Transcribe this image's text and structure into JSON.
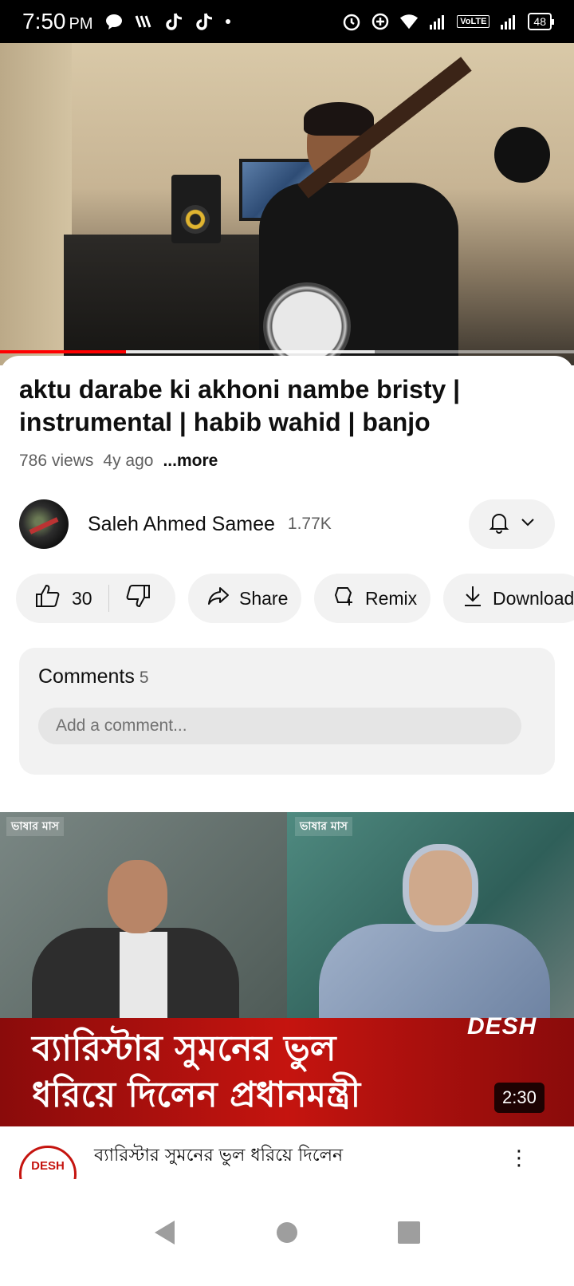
{
  "status_bar": {
    "time": "7:50",
    "ampm": "PM",
    "volte": "VoLTE",
    "battery": "48"
  },
  "player": {
    "progress_fraction": 0.22
  },
  "video": {
    "title": "aktu darabe ki akhoni nambe bristy | instrumental | habib wahid | banjo",
    "views": "786 views",
    "age": "4y ago",
    "more_label": "...more"
  },
  "channel": {
    "name": "Saleh Ahmed Samee",
    "subscribers": "1.77K"
  },
  "actions": {
    "likes": "30",
    "share": "Share",
    "remix": "Remix",
    "download": "Download"
  },
  "comments": {
    "title": "Comments",
    "count": "5",
    "placeholder": "Add a comment..."
  },
  "next_video": {
    "thumb_text_line1": "ব্যারিস্টার সুমনের ভুল",
    "thumb_text_line2": "ধরিয়ে দিলেন প্রধানমন্ত্রী",
    "logo": "DESH",
    "corner_badge_left": "ভাষার মাস",
    "corner_badge_right": "ভাষার মাস",
    "duration": "2:30",
    "title": "ব্যারিস্টার সুমনের ভুল ধরিয়ে দিলেন",
    "channel_logo": "DESH"
  },
  "colors": {
    "accent_red": "#ff0000",
    "pill_bg": "#f2f2f2",
    "secondary_text": "#606060"
  }
}
